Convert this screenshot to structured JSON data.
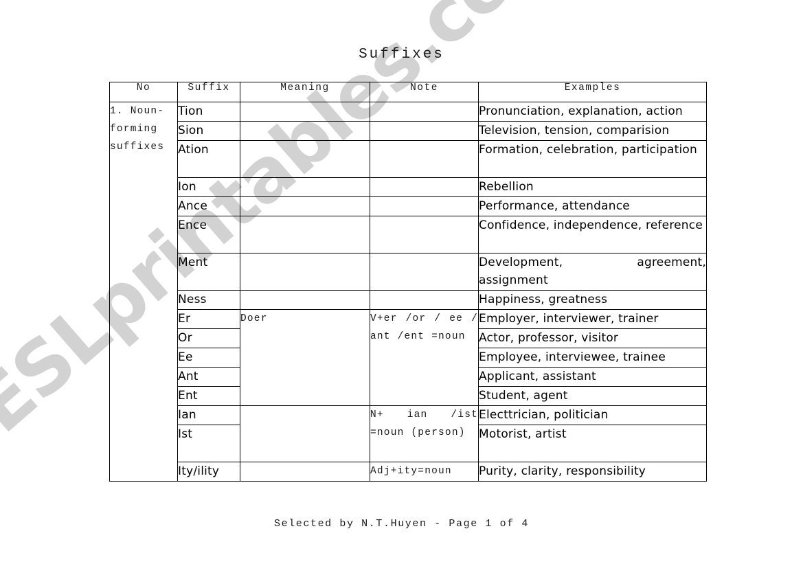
{
  "document": {
    "title": "Suffixes",
    "footer": "Selected by N.T.Huyen - Page 1 of 4",
    "watermark": "ESLprintables.com",
    "watermark_color": "#d2d2d2",
    "page_background": "#ffffff",
    "text_color": "#000000"
  },
  "table": {
    "headers": {
      "no": "No",
      "suffix": "Suffix",
      "meaning": "Meaning",
      "note": "Note",
      "examples": "Examples"
    },
    "group_label": "1. Noun-forming suffixes",
    "meaning_doer": "Doer",
    "note_verb_group": "V+er /or / ee / ant /ent =noun",
    "note_person_group": "N+ ian /ist =noun (person)",
    "note_ity": "Adj+ity=noun",
    "rows": [
      {
        "suffix": "Tion",
        "examples": "Pronunciation, explanation, action"
      },
      {
        "suffix": "Sion",
        "examples": "Television, tension, comparision"
      },
      {
        "suffix": "Ation",
        "examples": "Formation, celebration, participation"
      },
      {
        "suffix": "Ion",
        "examples": "Rebellion"
      },
      {
        "suffix": "Ance",
        "examples": "Performance, attendance"
      },
      {
        "suffix": "Ence",
        "examples": "Confidence, independence, reference"
      },
      {
        "suffix": "Ment",
        "examples": "Development, agreement, assignment"
      },
      {
        "suffix": "Ness",
        "examples": "Happiness, greatness"
      },
      {
        "suffix": "Er",
        "examples": "Employer, interviewer, trainer"
      },
      {
        "suffix": "Or",
        "examples": "Actor, professor, visitor"
      },
      {
        "suffix": "Ee",
        "examples": "Employee, interviewee, trainee"
      },
      {
        "suffix": "Ant",
        "examples": "Applicant, assistant"
      },
      {
        "suffix": "Ent",
        "examples": "Student, agent"
      },
      {
        "suffix": "Ian",
        "examples": "Electtrician, politician"
      },
      {
        "suffix": "Ist",
        "examples": "Motorist, artist"
      },
      {
        "suffix": "Ity/ility",
        "examples": "Purity, clarity, responsibility"
      }
    ]
  }
}
